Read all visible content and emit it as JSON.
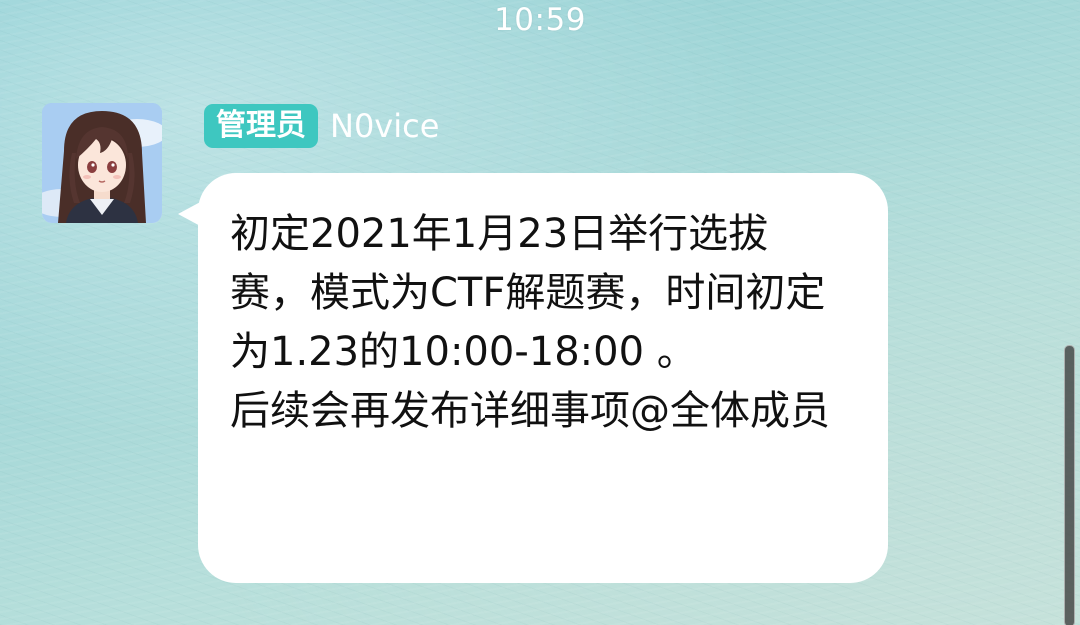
{
  "status_bar": {
    "time": "10:59"
  },
  "message": {
    "avatar_icon": "anime-girl-avatar",
    "role_badge": "管理员",
    "sender_name": "N0vice",
    "text": "初定2021年1月23日举行选拔赛，模式为CTF解题赛，时间初定为1.23的10:00-18:00 。\n后续会再发布详细事项@全体成员"
  },
  "colors": {
    "badge_background": "#3ec7c0",
    "bubble_background": "#ffffff",
    "wallpaper": "#a3d7d8"
  }
}
